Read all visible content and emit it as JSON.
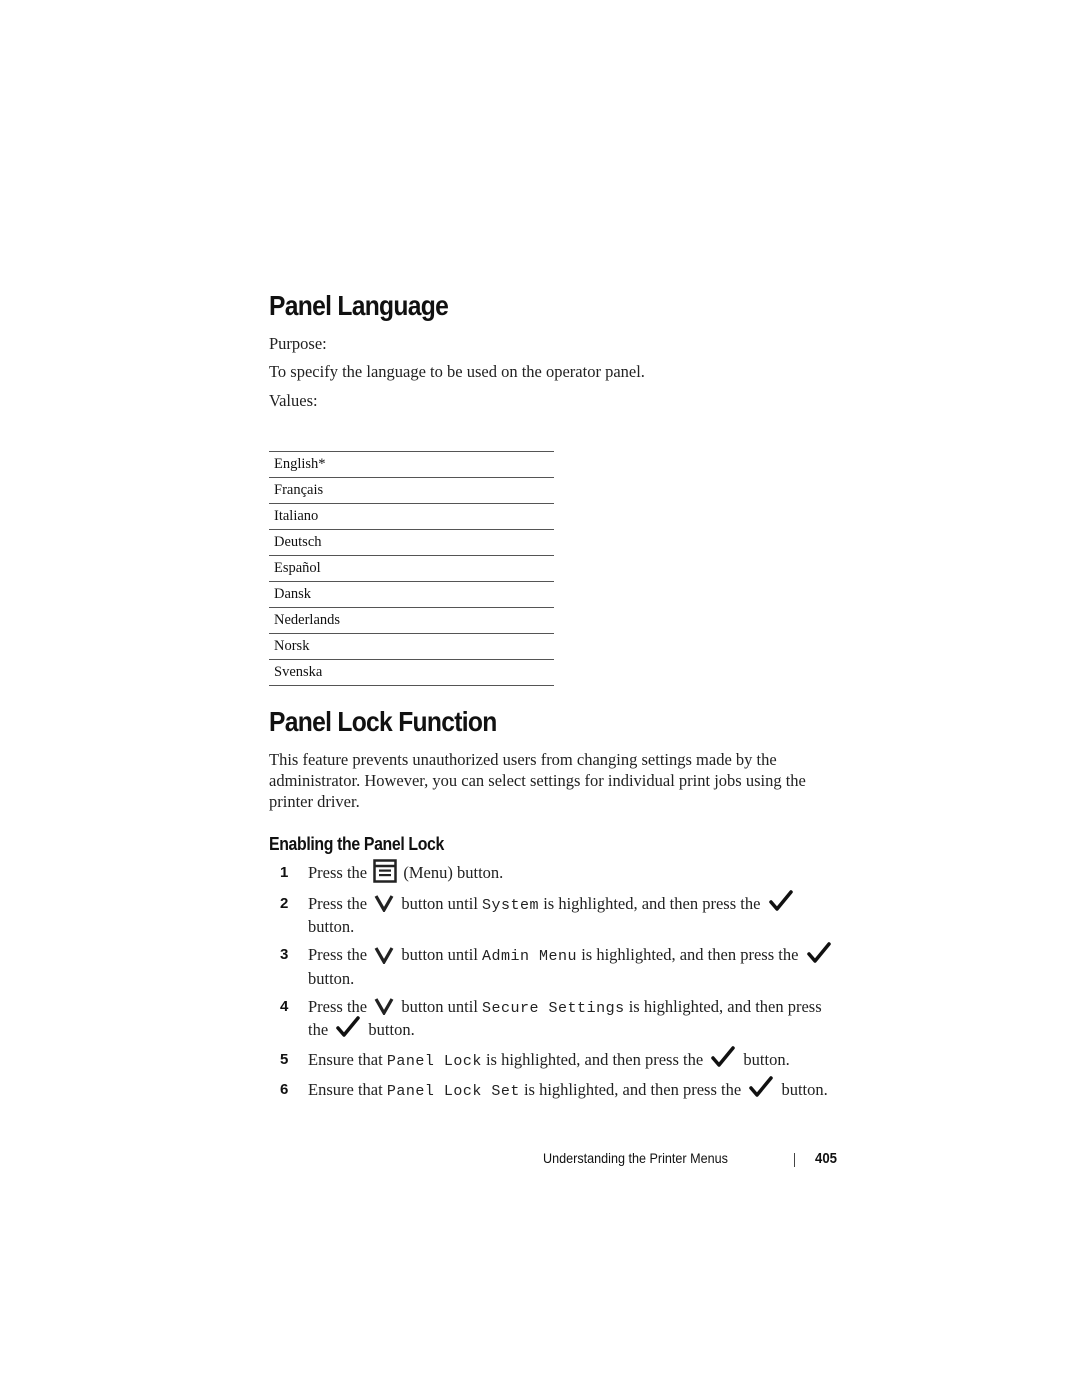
{
  "sections": {
    "panel_language": {
      "title": "Panel Language",
      "purpose_label": "Purpose:",
      "purpose_text": "To specify the language to be used on the operator panel.",
      "values_label": "Values:",
      "values": [
        "English*",
        "Français",
        "Italiano",
        "Deutsch",
        "Español",
        "Dansk",
        "Nederlands",
        "Norsk",
        "Svenska"
      ]
    },
    "panel_lock_function": {
      "title": "Panel Lock Function",
      "description": "This feature prevents unauthorized users from changing settings made by the administrator. However, you can select settings for individual print jobs using the printer driver.",
      "subsection_title": "Enabling the Panel Lock",
      "steps": [
        {
          "num": "1",
          "a": "Press the",
          "icon1": "menu-icon",
          "b": "(Menu) button."
        },
        {
          "num": "2",
          "a": "Press the",
          "icon1": "chevron-down-icon",
          "b": "button until",
          "code": "System",
          "c": "is highlighted, and then press the",
          "icon2": "checkmark-icon",
          "d": "button."
        },
        {
          "num": "3",
          "a": "Press the",
          "icon1": "chevron-down-icon",
          "b": "button until",
          "code": "Admin Menu",
          "c": "is highlighted, and then press the",
          "icon2": "checkmark-icon",
          "d": "button."
        },
        {
          "num": "4",
          "a": "Press the",
          "icon1": "chevron-down-icon",
          "b": "button until",
          "code": "Secure Settings",
          "c": "is highlighted, and then press the",
          "icon2": "checkmark-icon",
          "d": "button."
        },
        {
          "num": "5",
          "a": "Ensure that",
          "code": "Panel Lock",
          "c": "is highlighted, and then press the",
          "icon2": "checkmark-icon",
          "d": "button."
        },
        {
          "num": "6",
          "a": "Ensure that",
          "code": "Panel Lock Set",
          "c": "is highlighted, and then press the",
          "icon2": "checkmark-icon",
          "d": "button."
        }
      ]
    }
  },
  "footer": {
    "chapter": "Understanding the Printer Menus",
    "page_number": "405"
  }
}
